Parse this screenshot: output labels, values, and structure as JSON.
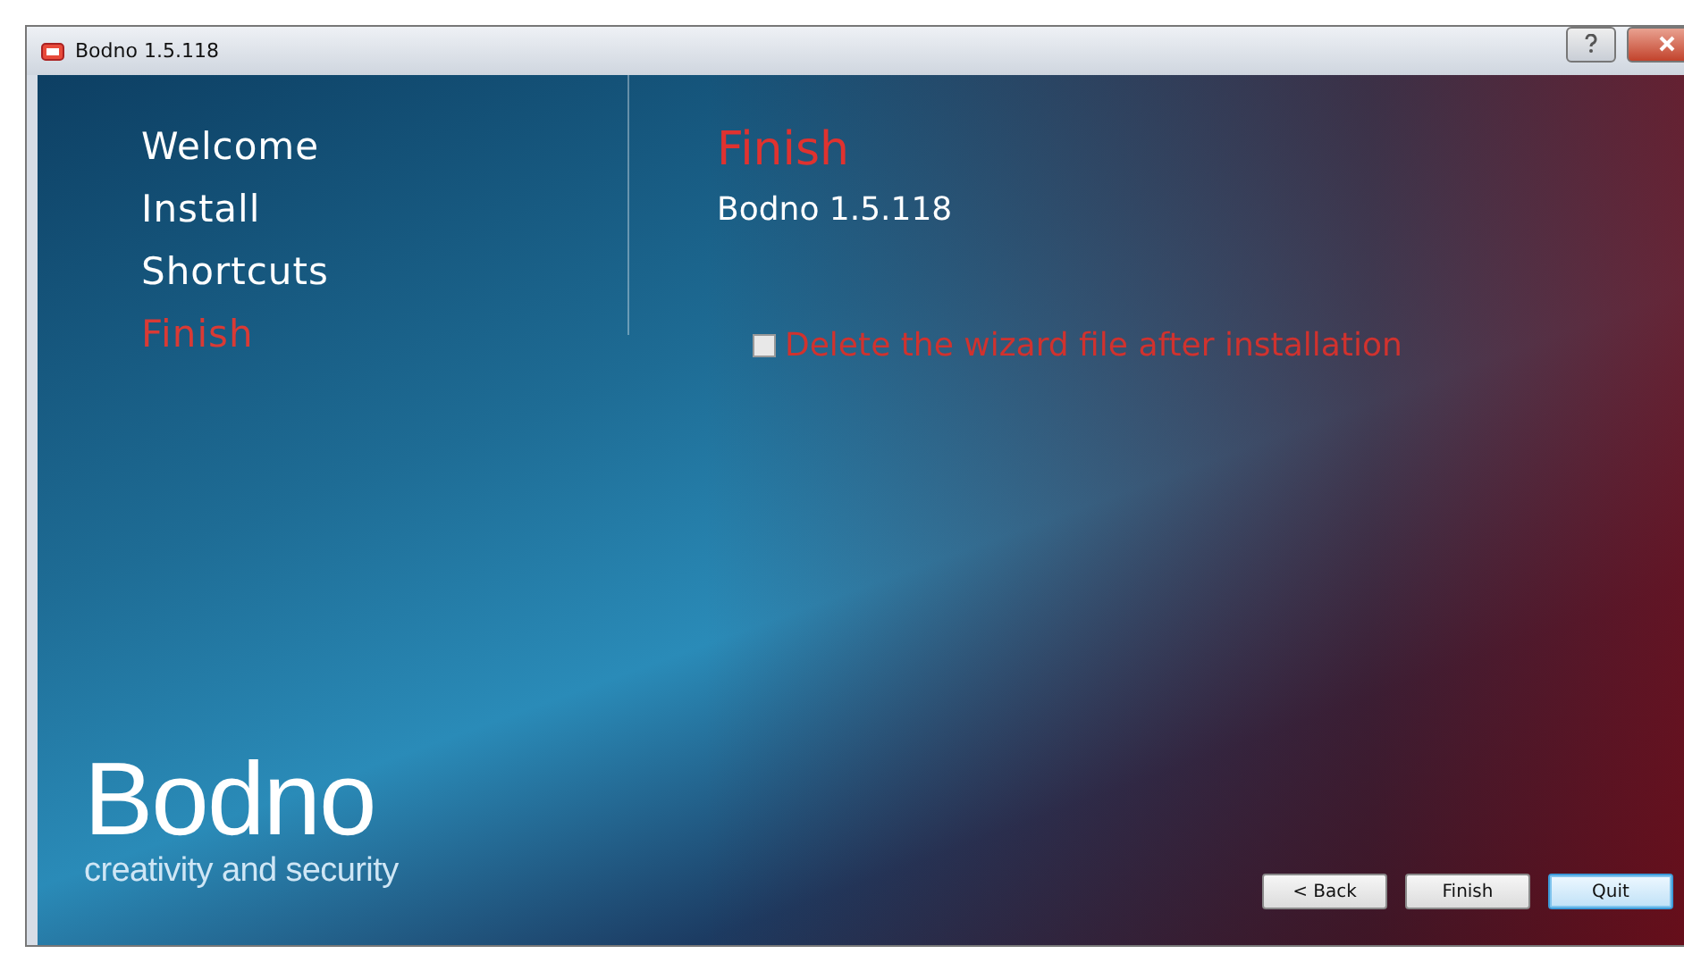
{
  "window": {
    "title": "Bodno 1.5.118"
  },
  "steps": [
    {
      "label": "Welcome",
      "selected": false
    },
    {
      "label": "Install",
      "selected": false
    },
    {
      "label": "Shortcuts",
      "selected": false
    },
    {
      "label": "Finish",
      "selected": true
    }
  ],
  "page": {
    "title": "Finish",
    "subtitle": "Bodno 1.5.118"
  },
  "option": {
    "label": "Delete the wizard file after installation",
    "checked": false
  },
  "logo": {
    "name": "Bodno",
    "tagline": "creativity and security"
  },
  "buttons": [
    {
      "label": "< Back",
      "default": false
    },
    {
      "label": "Finish",
      "default": false
    },
    {
      "label": "Quit",
      "default": true
    }
  ]
}
